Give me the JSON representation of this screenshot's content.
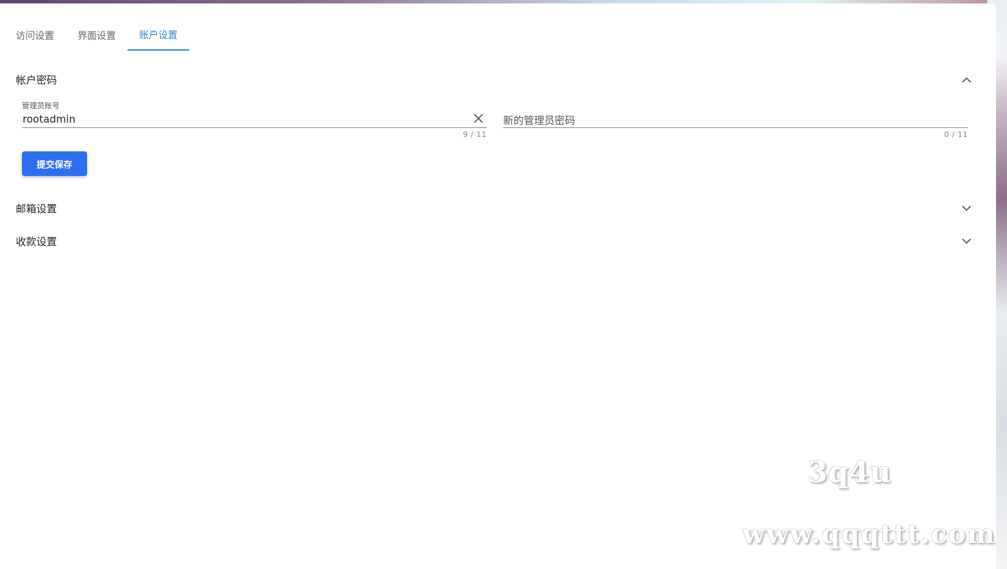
{
  "tabs": [
    {
      "label": "访问设置",
      "active": false
    },
    {
      "label": "界面设置",
      "active": false
    },
    {
      "label": "账户设置",
      "active": true
    }
  ],
  "panels": {
    "account_password": {
      "title": "帐户密码",
      "expanded": true,
      "admin_account": {
        "label": "管理员账号",
        "value": "rootadmin",
        "counter": "9 / 11"
      },
      "new_password": {
        "placeholder": "新的管理员密码",
        "value": "",
        "counter": "0 / 11"
      },
      "save_label": "提交保存"
    },
    "email": {
      "title": "邮箱设置",
      "expanded": false
    },
    "payment": {
      "title": "收款设置",
      "expanded": false
    }
  },
  "icons": {
    "expand": "chevron-up-icon",
    "collapse": "chevron-down-icon",
    "clear": "close-icon"
  },
  "colors": {
    "accent": "#2d86d6",
    "button": "#2e6ff2"
  },
  "watermark": {
    "line1": "3q4u",
    "line2": "www.qqqttt.com"
  }
}
